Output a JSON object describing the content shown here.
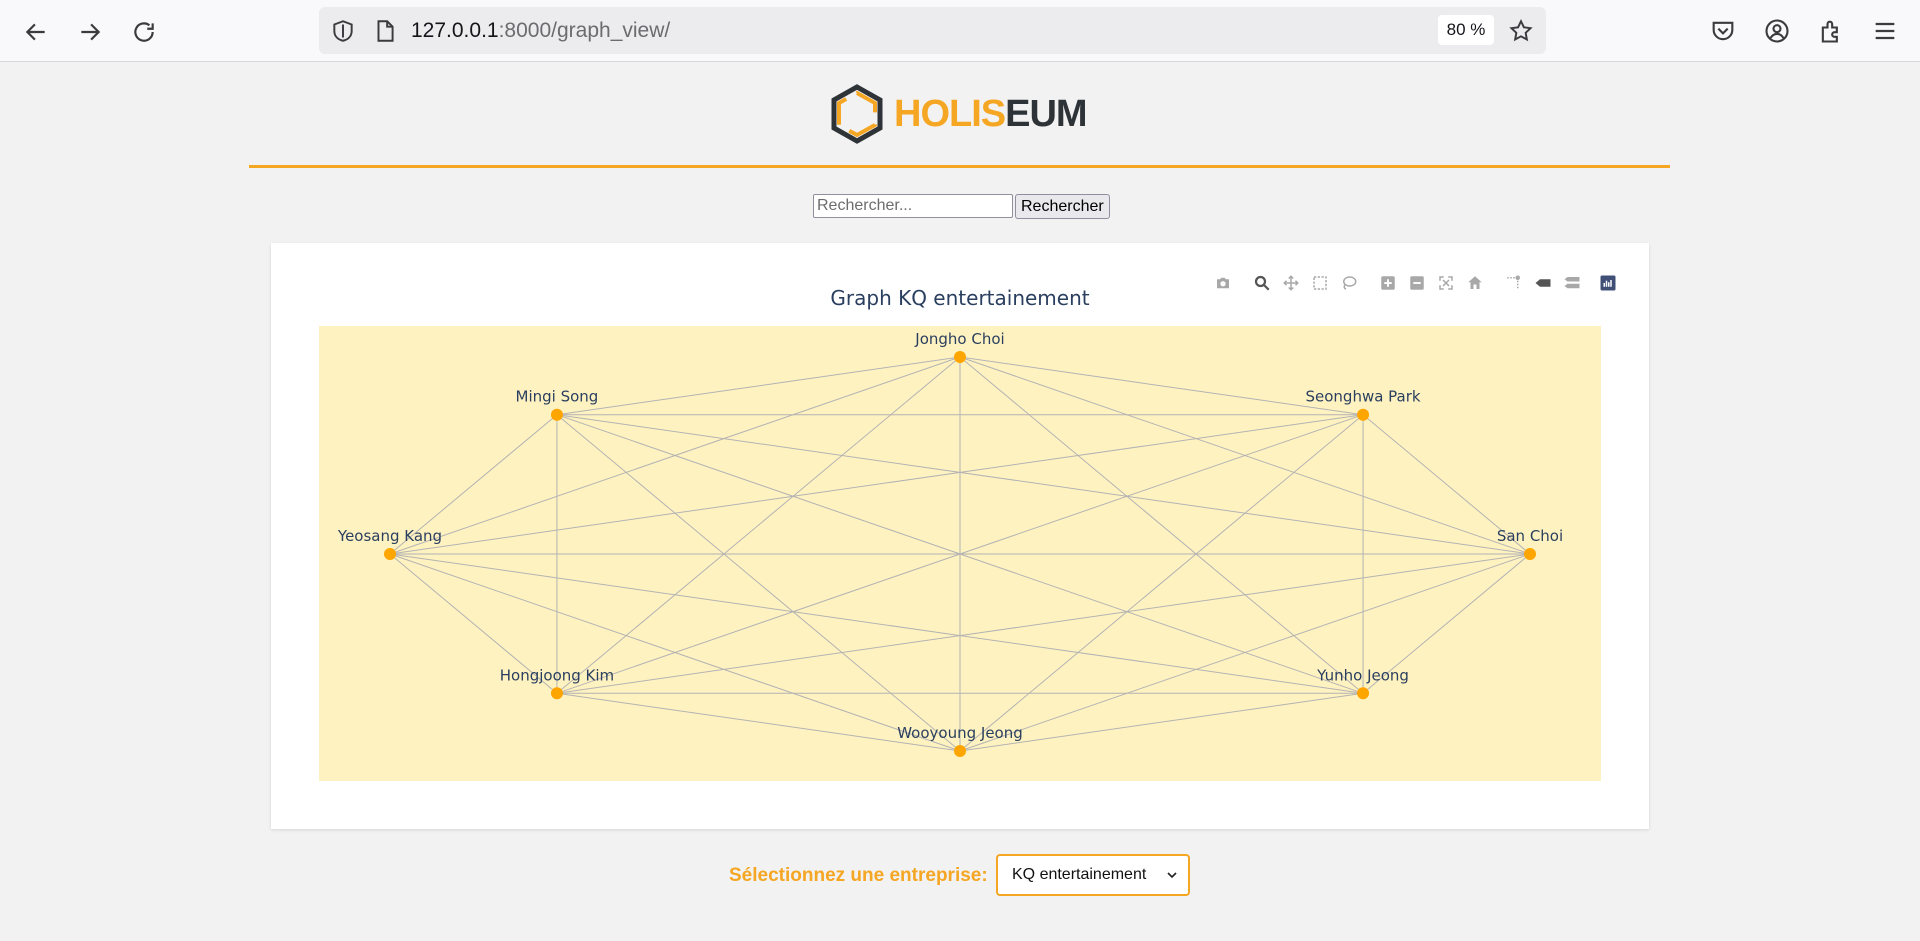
{
  "browser": {
    "url_host": "127.0.0.1",
    "url_path": ":8000/graph_view/",
    "zoom": "80 %"
  },
  "header": {
    "logo_part1": "HOLIS",
    "logo_part2": "EUM",
    "brand_color": "#f5a623",
    "dark_color": "#2e3338"
  },
  "search": {
    "placeholder": "Rechercher...",
    "button_label": "Rechercher"
  },
  "chart": {
    "title": "Graph KQ entertainement",
    "background": "#fff2c1",
    "node_color": "#ffa500",
    "edge_color": "#b3b3b3"
  },
  "chart_data": {
    "type": "network",
    "title": "Graph KQ entertainement",
    "layout": "circular",
    "nodes": [
      {
        "name": "Jongho Choi",
        "angle_deg": 90
      },
      {
        "name": "Seonghwa Park",
        "angle_deg": 45
      },
      {
        "name": "San Choi",
        "angle_deg": 0
      },
      {
        "name": "Yunho Jeong",
        "angle_deg": -45
      },
      {
        "name": "Wooyoung Jeong",
        "angle_deg": -90
      },
      {
        "name": "Hongjoong Kim",
        "angle_deg": -135
      },
      {
        "name": "Yeosang Kang",
        "angle_deg": 180
      },
      {
        "name": "Mingi Song",
        "angle_deg": 135
      }
    ],
    "edges": "complete",
    "grid": false,
    "legend": false
  },
  "selector": {
    "label": "Sélectionnez une entreprise:",
    "selected": "KQ entertainement"
  }
}
